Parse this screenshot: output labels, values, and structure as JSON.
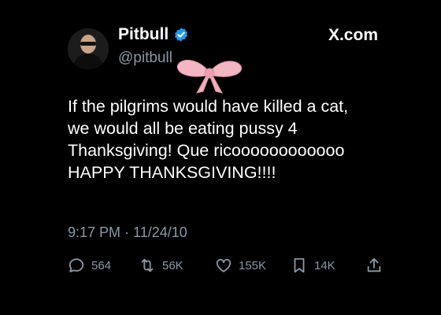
{
  "author": {
    "display_name": "Pitbull",
    "handle": "@pitbull",
    "verified": true
  },
  "site": "X.com",
  "tweet": {
    "text": "If the pilgrims would have killed a cat,\nwe would all be eating pussy 4\nThanksgiving!  Que ricoooooooooooo\nHAPPY THANKSGIVING!!!!",
    "timestamp": "9:17 PM · 11/24/10"
  },
  "actions": {
    "replies": "564",
    "reposts": "56K",
    "likes": "155K",
    "bookmarks": "14K"
  },
  "icons": [
    "avatar",
    "verified-badge-icon",
    "bow-sticker",
    "reply-icon",
    "repost-icon",
    "like-icon",
    "bookmark-icon",
    "share-icon"
  ],
  "colors": {
    "background": "#000000",
    "text": "#ffffff",
    "secondary": "#8b98a5",
    "verified": "#1d9bf0",
    "bow": "#f4b6c2"
  }
}
